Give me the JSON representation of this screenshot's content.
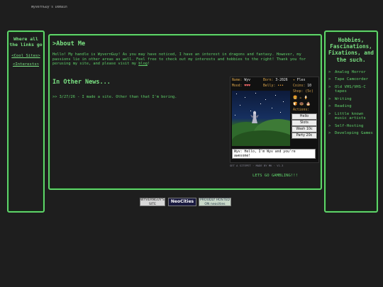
{
  "banner_text": "WyvernGuy's Domain",
  "left": {
    "title": "Where all the links go",
    "links": [
      "<Cool Sites>",
      "<Interests>"
    ]
  },
  "main": {
    "about_heading": ">About Me",
    "about_text_before": "Hello! My handle is WyvernGuy! As you may have noticed, I have an interest in dragons and fantasy. However, my passions lie in other areas as well. Feel free to check out my interests and hobbies to the right! Thank you for perusing my site, and please visit my ",
    "about_link": "blog",
    "about_text_after": "!",
    "news_heading": "In Other News...",
    "news_items": [
      ">>  3/27/26 - I made a site. Other than that I'm boring."
    ],
    "gambling_link": "LETS GO GAMBLING!!!"
  },
  "pet": {
    "name_label": "Name:",
    "name_value": "Wyv",
    "born_label": "Born:",
    "born_value": "3-2026",
    "status_value": "Flex",
    "mood_label": "Mood:",
    "mood_value": "♥♥♥",
    "belly_label": "Belly:",
    "belly_value": "•••",
    "coins_label": "Coins:",
    "coins_value": "10",
    "shop_label": "Shop: (5c)",
    "shop_row1": "🍔 ☕ 🍦",
    "shop_row2": "🍞 🍩 🎂",
    "actions_label": "Actions:",
    "buttons": [
      "Hello",
      "Slots",
      "Wash 10c",
      "Party 20c"
    ],
    "speech": "Wyv: Hello, I'm Wyv and you're awesome!",
    "credit": "GET A SITEPET · MADE BY MK · V1.3"
  },
  "right": {
    "title": "Hobbies, Fascinations, Fixations, and the such.",
    "items": [
      "Analog Horror",
      "Tape Camcorder",
      "Old VHS/VHS-C tapes",
      "Writing",
      "Reading",
      "Little known music artists",
      "Self-Hosting",
      "Developing Games"
    ]
  },
  "badges": [
    "WYVERNGUY'S SITE",
    "NeoCities",
    "PROUDLY HOSTED ON neocities"
  ],
  "colors": {
    "accent": "#5fd36a",
    "background": "#1e1e1e"
  }
}
